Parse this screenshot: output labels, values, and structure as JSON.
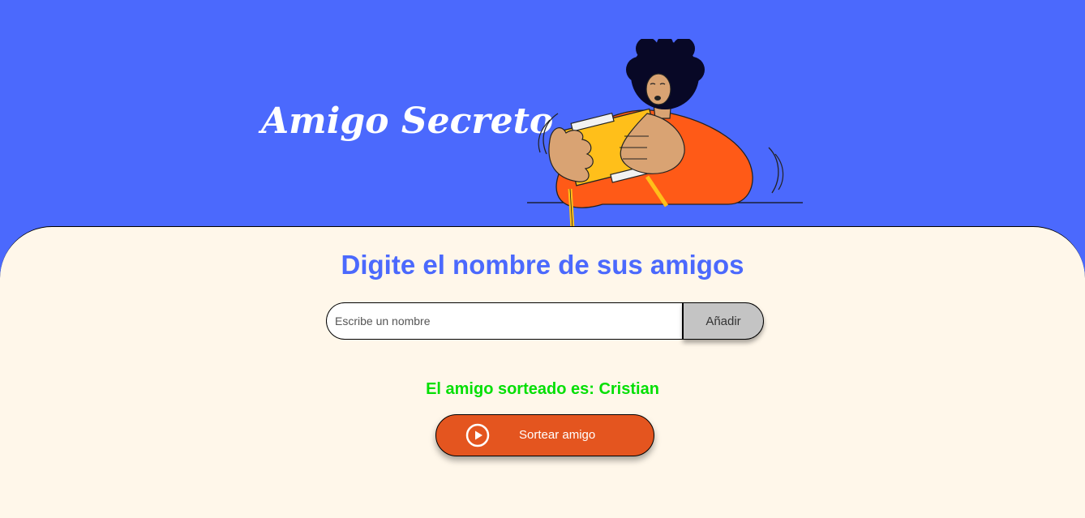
{
  "header": {
    "title": "Amigo Secreto",
    "illustration_icon": "person-playing-game-illustration"
  },
  "main": {
    "subtitle": "Digite el nombre de sus amigos",
    "input": {
      "value": "",
      "placeholder": "Escribe un nombre"
    },
    "add_button_label": "Añadir",
    "result_text": "El amigo sorteado es: Cristian",
    "draw_button": {
      "label": "Sortear amigo",
      "icon": "play-circle-icon"
    }
  },
  "colors": {
    "header_bg": "#4b69fd",
    "main_bg": "#fff7ea",
    "subtitle": "#4b69fd",
    "result": "#05df05",
    "draw_button": "#e4551f",
    "add_button": "#c4c4c4"
  }
}
